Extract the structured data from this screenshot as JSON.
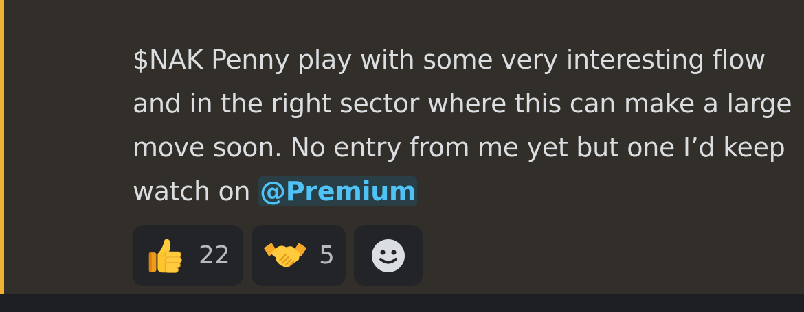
{
  "message": {
    "text": "$NAK Penny play with some very interesting flow and in the right sector where this can make a large move soon. No entry from me yet but one I’d keep watch on",
    "mention": "@Premium"
  },
  "reactions": [
    {
      "emoji": "thumbs-up-icon",
      "count": "22"
    },
    {
      "emoji": "handshake-icon",
      "count": "5"
    }
  ],
  "add_reaction": {
    "icon": "smiley-add-reaction-icon"
  },
  "colors": {
    "highlight_bar": "#f0b232",
    "mention_text": "#4fc3f7",
    "message_bg": "#322f2a"
  }
}
